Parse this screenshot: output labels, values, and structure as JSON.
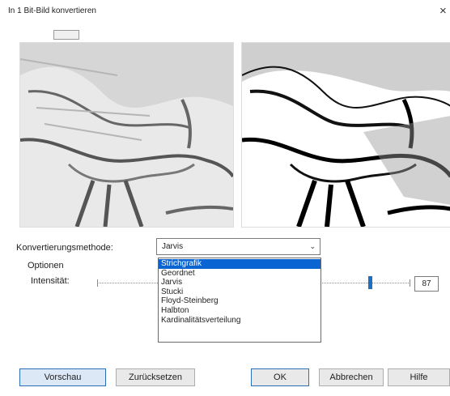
{
  "window": {
    "title": "In 1 Bit-Bild konvertieren",
    "close_glyph": "×"
  },
  "method": {
    "label": "Konvertierungsmethode:",
    "selected": "Jarvis",
    "options": [
      "Strichgrafik",
      "Geordnet",
      "Jarvis",
      "Stucki",
      "Floyd-Steinberg",
      "Halbton",
      "Kardinalitätsverteilung"
    ],
    "highlighted": "Strichgrafik"
  },
  "options_group": {
    "label": "Optionen"
  },
  "intensity": {
    "label": "Intensität:",
    "value": "87",
    "level": 0.87
  },
  "buttons": {
    "preview": "Vorschau",
    "reset": "Zurücksetzen",
    "ok": "OK",
    "cancel": "Abbrechen",
    "help": "Hilfe"
  },
  "colors": {
    "accent": "#0a64d2",
    "thumb": "#1f6fbf"
  },
  "icons": {
    "close": "close-icon",
    "dropdown": "chevron-down-icon"
  }
}
